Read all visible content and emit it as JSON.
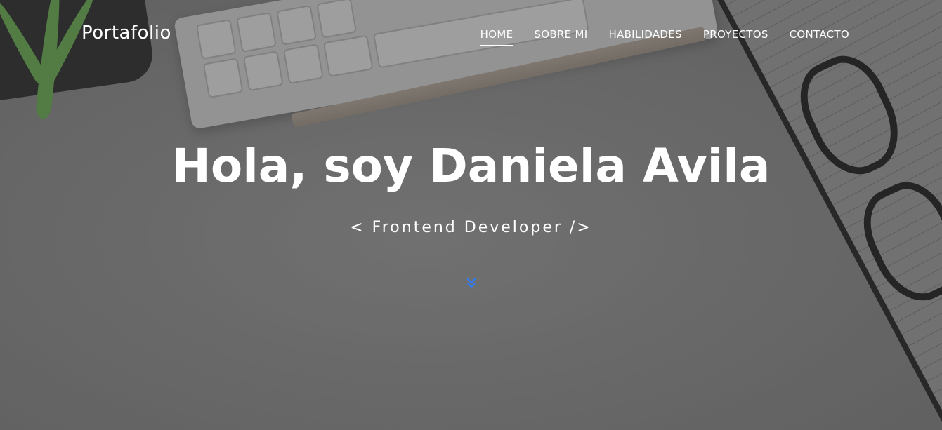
{
  "brand": "Portafolio",
  "nav": [
    {
      "label": "HOME",
      "active": true
    },
    {
      "label": "SOBRE MI",
      "active": false
    },
    {
      "label": "HABILIDADES",
      "active": false
    },
    {
      "label": "PROYECTOS",
      "active": false
    },
    {
      "label": "CONTACTO",
      "active": false
    }
  ],
  "hero": {
    "title": "Hola, soy Daniela Avila",
    "subtitle": "< Frontend Developer />",
    "scroll_icon": "double-chevron-down-icon"
  },
  "colors": {
    "accent": "#2f7df6",
    "text": "#ffffff"
  }
}
